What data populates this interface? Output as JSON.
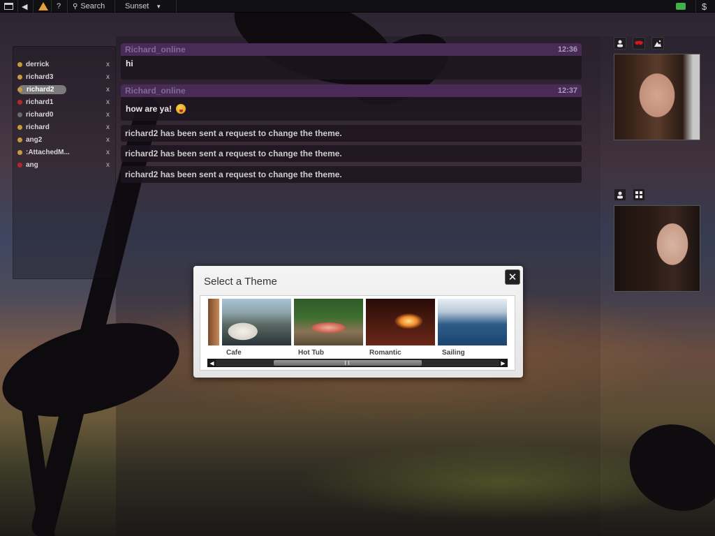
{
  "topbar": {
    "search_label": "Search",
    "theme_label": "Sunset",
    "help_label": "?"
  },
  "users": [
    {
      "name": "derrick",
      "status_color": "#c89a3c"
    },
    {
      "name": "richard3",
      "status_color": "#c89a3c"
    },
    {
      "name": "richard2",
      "status_color": "#c89a3c",
      "selected": true
    },
    {
      "name": "richard1",
      "status_color": "#b02a2a"
    },
    {
      "name": "richard0",
      "status_color": "#6a6a6a"
    },
    {
      "name": "richard",
      "status_color": "#c89a3c"
    },
    {
      "name": "ang2",
      "status_color": "#c89a3c"
    },
    {
      "name": ":AttachedM...",
      "status_color": "#c89a3c"
    },
    {
      "name": "ang",
      "status_color": "#b02a2a"
    }
  ],
  "remove_label": "x",
  "messages": [
    {
      "sender": "Richard_online",
      "time": "12:36",
      "text": "hi"
    },
    {
      "sender": "Richard_online",
      "time": "12:37",
      "text": "how are ya!"
    }
  ],
  "system_messages": [
    "richard2 has been sent a request to change the theme.",
    "richard2 has been sent a request to change the theme.",
    "richard2 has been sent a request to change the theme."
  ],
  "modal": {
    "title": "Select a Theme",
    "close_label": "✕",
    "themes": [
      "Cafe",
      "Hot Tub",
      "Romantic",
      "Sailing"
    ]
  },
  "colors": {
    "header_purple": "#4a2b58",
    "sender_name": "#7f6a96",
    "away_status": "#c89a3c",
    "busy_status": "#b02a2a"
  }
}
